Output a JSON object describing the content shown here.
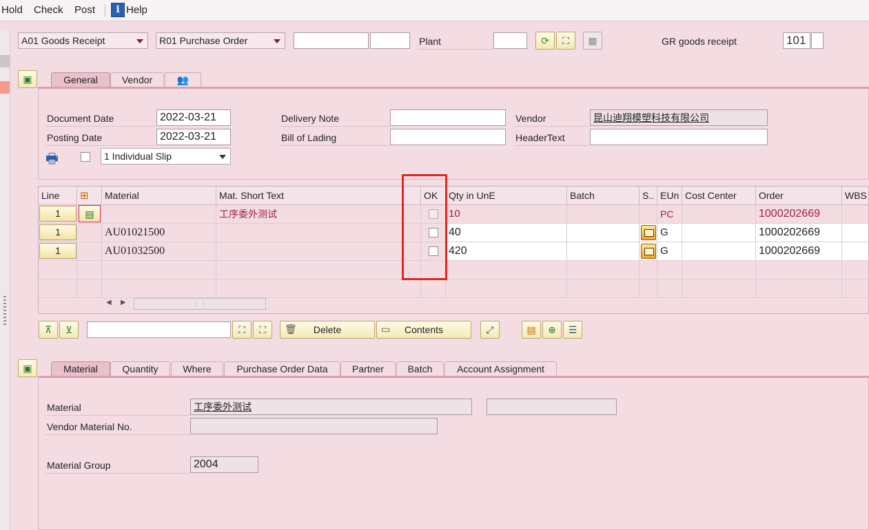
{
  "menu": {
    "hold": "Hold",
    "check": "Check",
    "post": "Post",
    "help": "Help"
  },
  "header": {
    "action_dd": "A01 Goods Receipt",
    "ref_dd": "R01 Purchase Order",
    "ref_input1": "",
    "ref_input2": "",
    "plant_label": "Plant",
    "plant_value": "",
    "gr_label": "GR goods receipt",
    "movement_type": "101",
    "movement_type2": ""
  },
  "header_tabs": {
    "general": "General",
    "vendor": "Vendor"
  },
  "general": {
    "doc_date_label": "Document Date",
    "doc_date": "2022-03-21",
    "post_date_label": "Posting Date",
    "post_date": "2022-03-21",
    "delivery_note_label": "Delivery Note",
    "delivery_note": "",
    "bill_of_lading_label": "Bill of Lading",
    "bill_of_lading": "",
    "vendor_label": "Vendor",
    "vendor_value": "昆山迪翔模塑科技有限公司",
    "header_text_label": "HeaderText",
    "header_text": "",
    "slip_dd": "1 Individual Slip"
  },
  "table": {
    "headers": {
      "line": "Line",
      "material": "Material",
      "short_text": "Mat. Short Text",
      "ok": "OK",
      "qty": "Qty in UnE",
      "batch": "Batch",
      "s": "S..",
      "eun": "EUn",
      "cost_center": "Cost Center",
      "order": "Order",
      "wbs": "WBS"
    },
    "rows": [
      {
        "line": "1",
        "material": "",
        "short_text": "工序委外测试",
        "qty": "10",
        "batch": "",
        "eun": "PC",
        "cost_center": "",
        "order": "1000202669"
      },
      {
        "line": "1",
        "material": "AU01021500",
        "short_text": "",
        "qty": "40",
        "batch": "",
        "eun": "G",
        "cost_center": "",
        "order": "1000202669"
      },
      {
        "line": "1",
        "material": "AU01032500",
        "short_text": "",
        "qty": "420",
        "batch": "",
        "eun": "G",
        "cost_center": "",
        "order": "1000202669"
      }
    ]
  },
  "toolbar": {
    "search_value": "",
    "delete_label": "Delete",
    "contents_label": "Contents"
  },
  "item_tabs": {
    "material": "Material",
    "quantity": "Quantity",
    "where": "Where",
    "po_data": "Purchase Order Data",
    "partner": "Partner",
    "batch": "Batch",
    "account": "Account Assignment"
  },
  "item_detail": {
    "material_label": "Material",
    "material_value": "工序委外测试",
    "material_extra": "",
    "vendor_mat_label": "Vendor Material No.",
    "vendor_mat_value": "",
    "mat_group_label": "Material Group",
    "mat_group_value": "2004"
  },
  "colors": {
    "accent_red": "#e0281f",
    "tab_active": "#e9c0cb",
    "background": "#f3dde3"
  }
}
